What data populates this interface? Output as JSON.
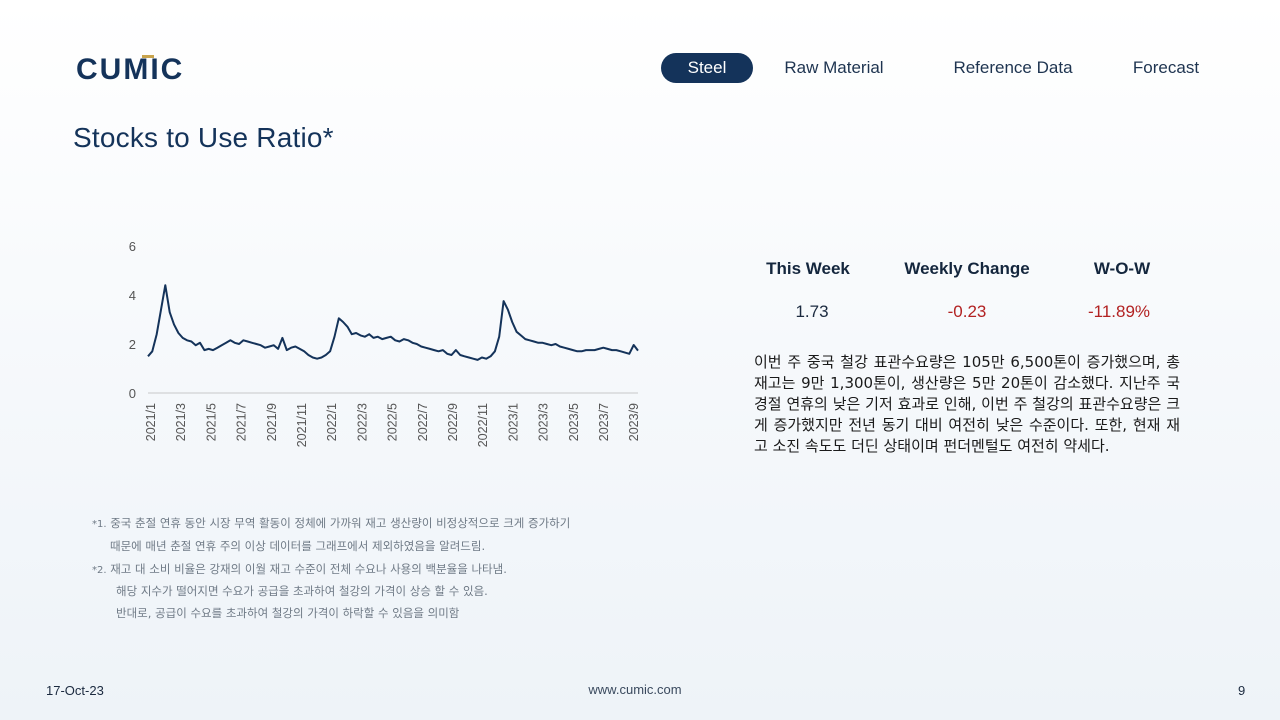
{
  "brand": {
    "name": "CUMIC",
    "color": "#14335a",
    "accent": "#c9a44c"
  },
  "nav": {
    "items": [
      {
        "label": "Steel",
        "active": true
      },
      {
        "label": "Raw Material",
        "active": false
      },
      {
        "label": "Reference Data",
        "active": false
      },
      {
        "label": "Forecast",
        "active": false
      }
    ]
  },
  "page": {
    "title": "Stocks to Use Ratio*"
  },
  "chart_data": {
    "type": "line",
    "title": "",
    "xlabel": "",
    "ylabel": "",
    "ylim": [
      0,
      6
    ],
    "yticks": [
      0,
      2,
      4,
      6
    ],
    "grid": false,
    "legend": "none",
    "line_color": "#14335a",
    "xtick_labels": [
      "2021/1",
      "2021/3",
      "2021/5",
      "2021/7",
      "2021/9",
      "2021/11",
      "2022/1",
      "2022/3",
      "2022/5",
      "2022/7",
      "2022/9",
      "2022/11",
      "2023/1",
      "2023/3",
      "2023/5",
      "2023/7",
      "2023/9"
    ],
    "series": [
      {
        "values": [
          1.5,
          1.7,
          2.4,
          3.4,
          4.4,
          3.3,
          2.8,
          2.45,
          2.25,
          2.15,
          2.1,
          1.95,
          2.05,
          1.75,
          1.8,
          1.75,
          1.85,
          1.95,
          2.05,
          2.15,
          2.05,
          2.0,
          2.15,
          2.1,
          2.05,
          2.0,
          1.95,
          1.85,
          1.9,
          1.95,
          1.8,
          2.25,
          1.75,
          1.85,
          1.9,
          1.8,
          1.7,
          1.55,
          1.45,
          1.4,
          1.45,
          1.55,
          1.7,
          2.3,
          3.05,
          2.9,
          2.7,
          2.4,
          2.45,
          2.35,
          2.3,
          2.4,
          2.25,
          2.3,
          2.2,
          2.25,
          2.3,
          2.15,
          2.1,
          2.2,
          2.15,
          2.05,
          2.0,
          1.9,
          1.85,
          1.8,
          1.75,
          1.7,
          1.75,
          1.6,
          1.55,
          1.75,
          1.55,
          1.5,
          1.45,
          1.4,
          1.35,
          1.45,
          1.4,
          1.5,
          1.7,
          2.3,
          3.75,
          3.4,
          2.9,
          2.5,
          2.35,
          2.2,
          2.15,
          2.1,
          2.05,
          2.05,
          2.0,
          1.95,
          2.0,
          1.9,
          1.85,
          1.8,
          1.75,
          1.7,
          1.7,
          1.75,
          1.75,
          1.75,
          1.8,
          1.85,
          1.8,
          1.75,
          1.75,
          1.7,
          1.65,
          1.6,
          1.96,
          1.73
        ]
      }
    ]
  },
  "stats": {
    "headers": [
      "This Week",
      "Weekly Change",
      "W-O-W"
    ],
    "values": [
      "1.73",
      "-0.23",
      "-11.89%"
    ],
    "value_colors": [
      "#1b2a3f",
      "#b22222",
      "#b22222"
    ]
  },
  "description": "이번 주 중국 철강 표관수요량은 105만 6,500톤이 증가했으며, 총재고는 9만 1,300톤이, 생산량은 5만 20톤이 감소했다. 지난주 국경절 연휴의 낮은 기저 효과로 인해, 이번 주 철강의 표관수요량은 크게 증가했지만 전년 동기 대비 여전히 낮은 수준이다. 또한, 현재 재고 소진 속도도 더딘 상태이며 펀더멘털도 여전히 약세다.",
  "notes": [
    {
      "num": "*1.",
      "lines": [
        "중국 춘절 연휴 동안 시장 무역 활동이 정체에 가까워 재고 생산량이 비정상적으로 크게 증가하기",
        "때문에 매년 춘절 연휴 주의 이상 데이터를 그래프에서 제외하였음을 알려드림."
      ]
    },
    {
      "num": "*2.",
      "lines": [
        "재고 대 소비 비율은 강재의 이월 재고 수준이 전체 수요나 사용의 백분율을 나타냄.",
        "해당 지수가 떨어지면 수요가 공급을 초과하여 철강의 가격이 상승 할 수 있음.",
        "반대로, 공급이 수요를 초과하여 철강의 가격이 하락할 수 있음을 의미함"
      ]
    }
  ],
  "footer": {
    "date": "17-Oct-23",
    "url": "www.cumic.com",
    "page": "9"
  }
}
